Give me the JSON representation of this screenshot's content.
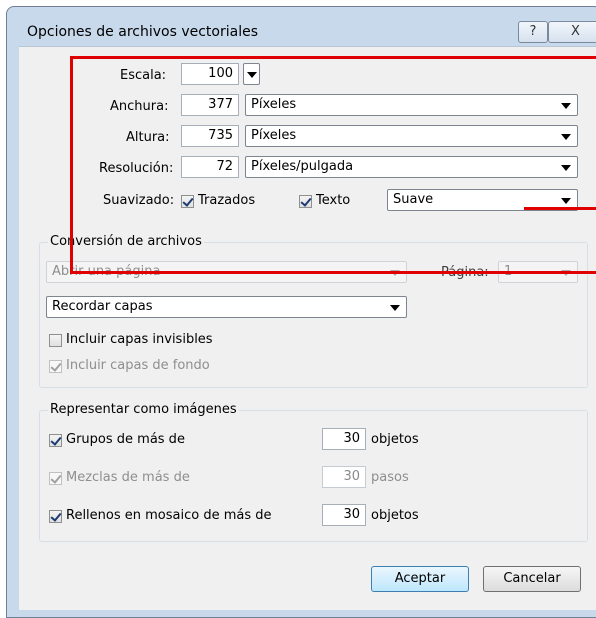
{
  "window": {
    "title": "Opciones de archivos vectoriales",
    "help_glyph": "?",
    "close_glyph": "X"
  },
  "scale": {
    "label": "Escala:",
    "value": "100"
  },
  "width": {
    "label": "Anchura:",
    "value": "377",
    "unit": "Píxeles"
  },
  "height": {
    "label": "Altura:",
    "value": "735",
    "unit": "Píxeles"
  },
  "resolution": {
    "label": "Resolución:",
    "value": "72",
    "unit": "Píxeles/pulgada"
  },
  "antialias": {
    "label": "Suavizado:",
    "paths_label": "Trazados",
    "paths_checked": true,
    "text_label": "Texto",
    "text_checked": true,
    "mode": "Suave"
  },
  "file_conversion": {
    "title": "Conversión de archivos",
    "page_mode": "Abrir una página",
    "page_label": "Página:",
    "page_value": "1",
    "layers_mode": "Recordar capas",
    "include_invisible_label": "Incluir capas invisibles",
    "include_invisible_checked": false,
    "include_background_label": "Incluir capas de fondo",
    "include_background_checked": true
  },
  "render_as_images": {
    "title": "Representar como imágenes",
    "groups_label": "Grupos de más de",
    "groups_checked": true,
    "groups_value": "30",
    "groups_unit": "objetos",
    "blends_label": "Mezclas de más de",
    "blends_checked": true,
    "blends_value": "30",
    "blends_unit": "pasos",
    "tiled_label": "Rellenos en mosaico de más de",
    "tiled_checked": true,
    "tiled_value": "30",
    "tiled_unit": "objetos"
  },
  "buttons": {
    "ok": "Aceptar",
    "cancel": "Cancelar"
  },
  "colors": {
    "annotation": "#e00000",
    "frame": "#c9d9ec",
    "client": "#f0f0f0"
  }
}
